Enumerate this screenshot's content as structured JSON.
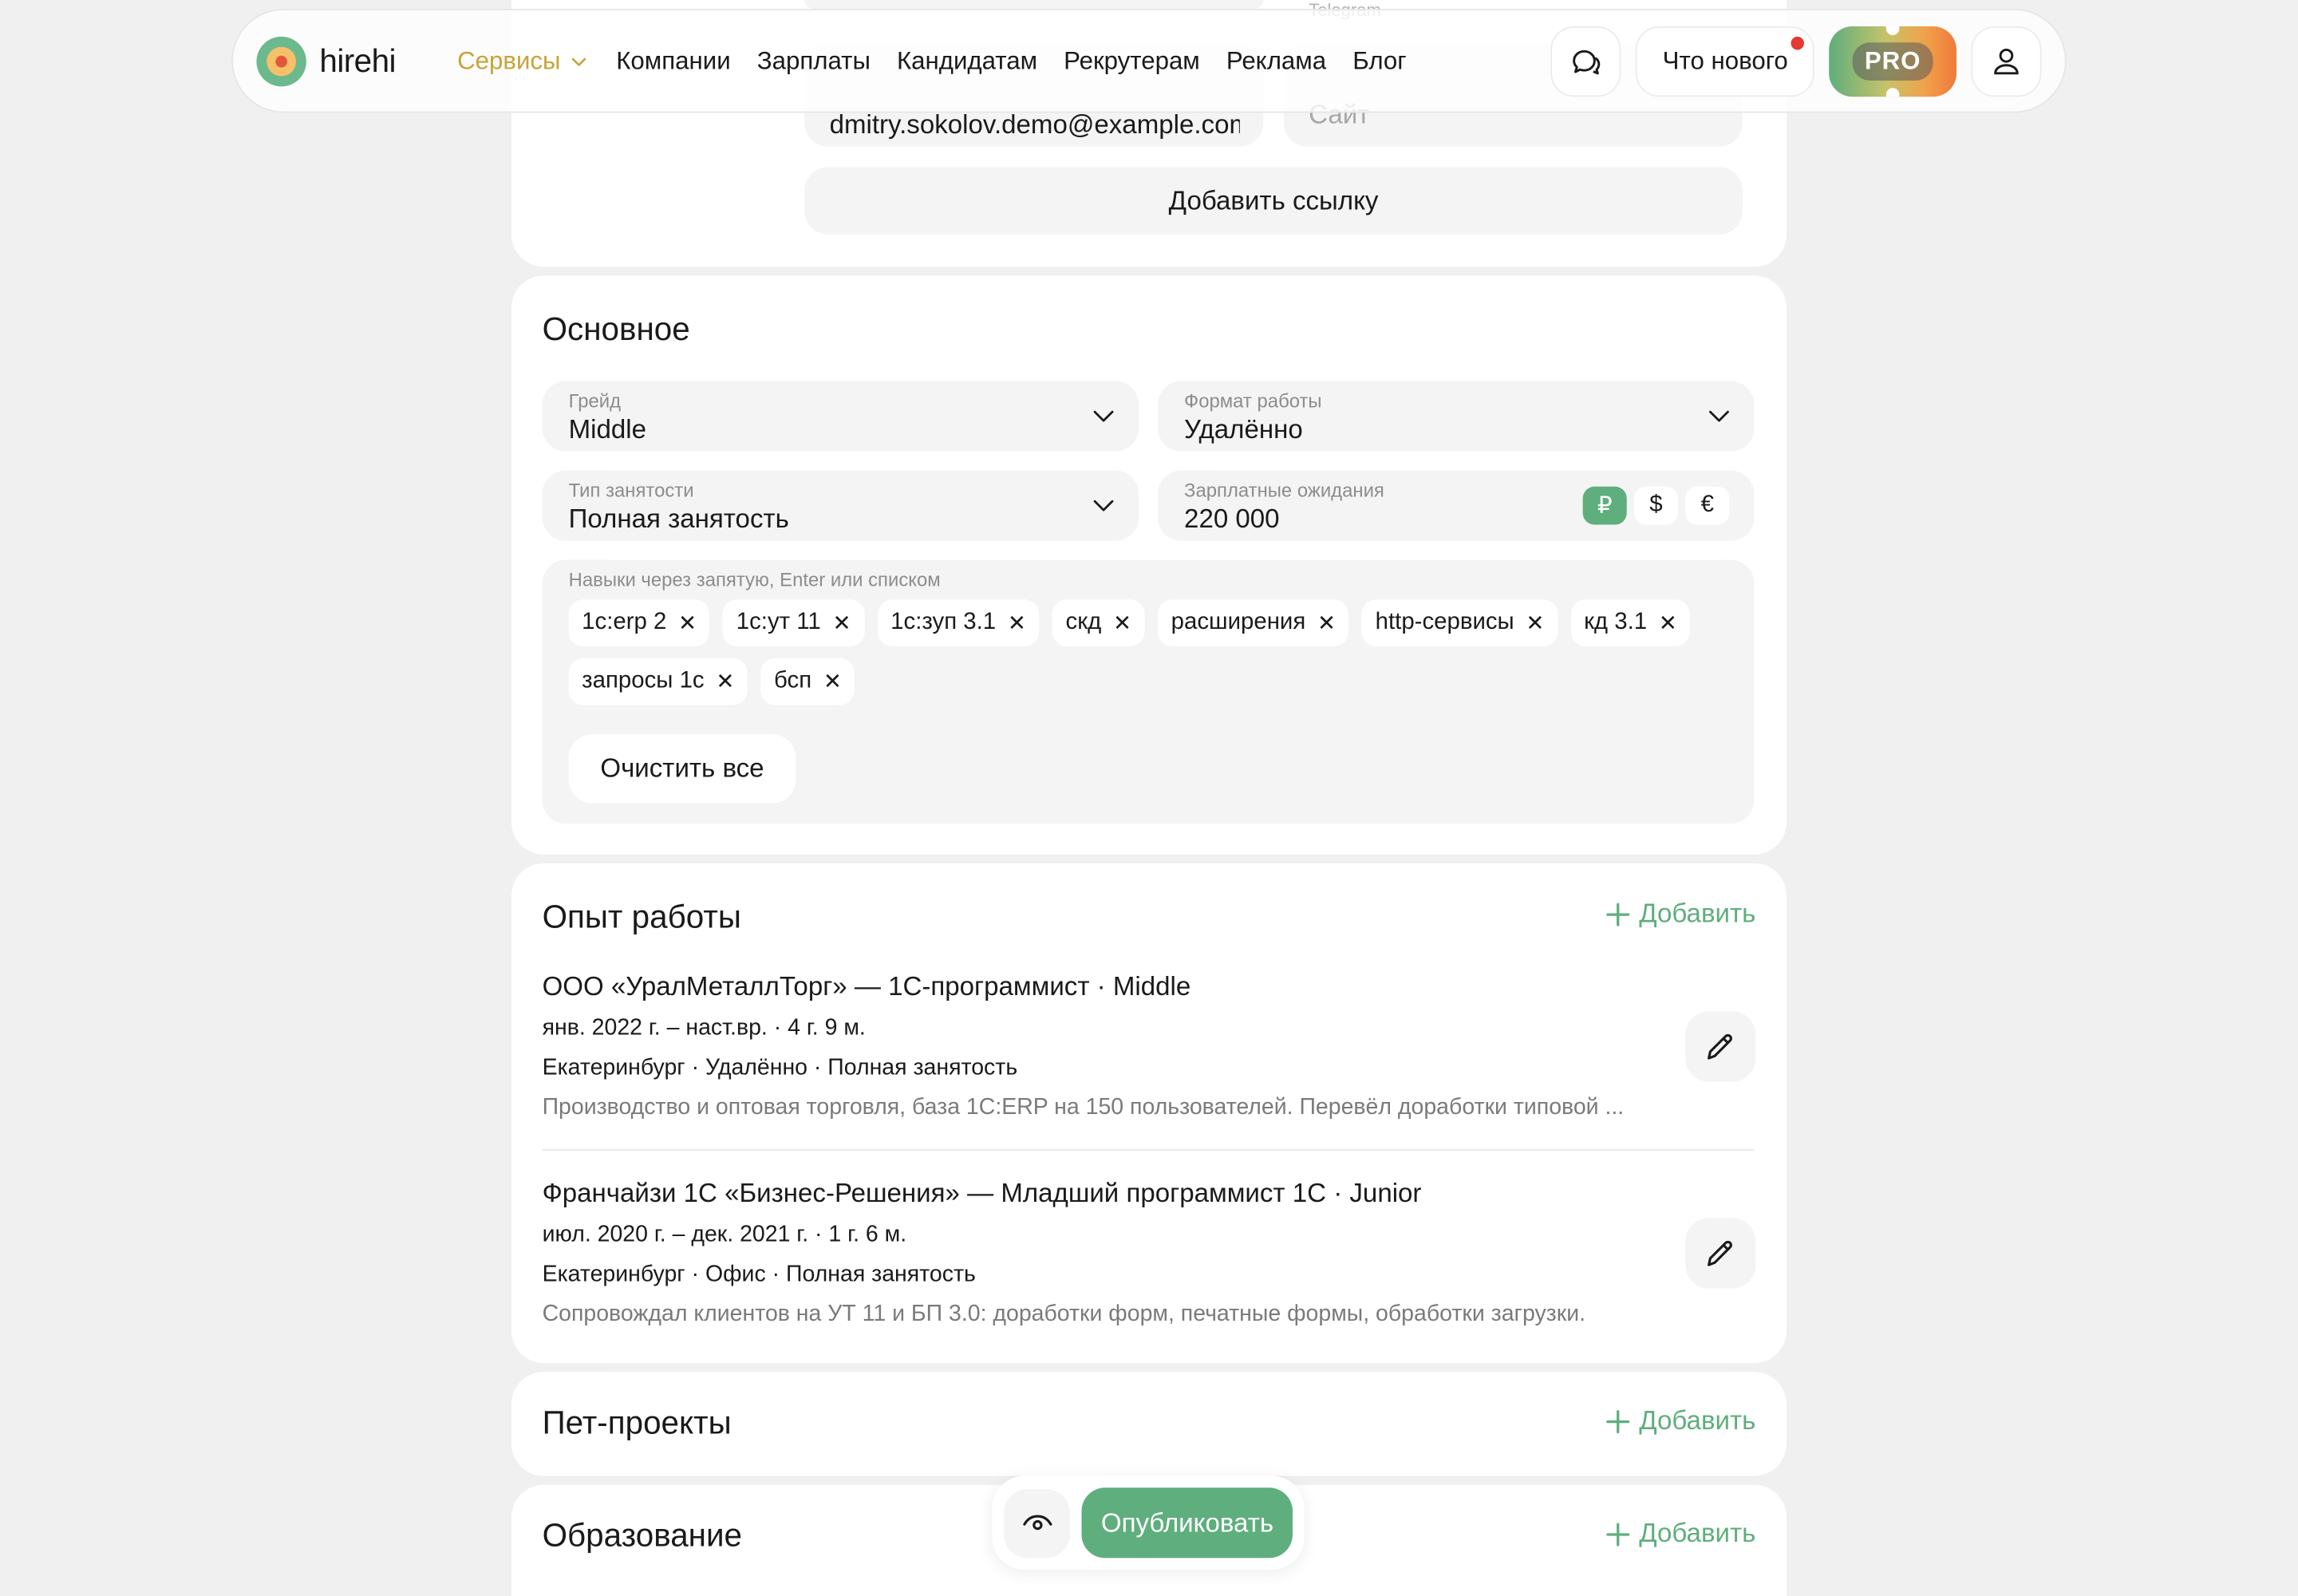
{
  "header": {
    "logo_text": "hirehi",
    "nav": {
      "services": "Сервисы",
      "companies": "Компании",
      "salaries": "Зарплаты",
      "candidates": "Кандидатам",
      "recruiters": "Рекрутерам",
      "ads": "Реклама",
      "blog": "Блог"
    },
    "whats_new": "Что нового",
    "pro": "PRO",
    "accent_color": "#5fae7d",
    "services_color": "#c8a33a"
  },
  "contacts": {
    "telegram_label": "Telegram",
    "email_value": "dmitry.sokolov.demo@example.com",
    "site_placeholder": "Сайт",
    "add_link": "Добавить ссылку"
  },
  "basic": {
    "title": "Основное",
    "grade": {
      "label": "Грейд",
      "value": "Middle"
    },
    "work_format": {
      "label": "Формат работы",
      "value": "Удалённо"
    },
    "employment": {
      "label": "Тип занятости",
      "value": "Полная занятость"
    },
    "salary": {
      "label": "Зарплатные ожидания",
      "value": "220 000",
      "currencies": [
        "₽",
        "$",
        "€"
      ],
      "selected_currency": "₽"
    },
    "skills_label": "Навыки через запятую, Enter или списком",
    "skills": [
      "1с:erp 2",
      "1с:ут 11",
      "1с:зуп 3.1",
      "скд",
      "расширения",
      "http-сервисы",
      "кд 3.1",
      "запросы 1с",
      "бсп"
    ],
    "clear_all": "Очистить все"
  },
  "experience": {
    "title": "Опыт работы",
    "add": "Добавить",
    "items": [
      {
        "title": "ООО «УралМеталлТорг» — 1С-программист · Middle",
        "period": "янв. 2022 г. – наст.вр. · 4 г. 9 м.",
        "meta": "Екатеринбург · Удалённо · Полная занятость",
        "description": "Производство и оптовая торговля, база 1С:ERP на 150 пользователей. Перевёл доработки типовой ..."
      },
      {
        "title": "Франчайзи 1С «Бизнес-Решения» — Младший программист 1С · Junior",
        "period": "июл. 2020 г. – дек. 2021 г. · 1 г. 6 м.",
        "meta": "Екатеринбург · Офис · Полная занятость",
        "description": "Сопровождал клиентов на УТ 11 и БП 3.0: доработки форм, печатные формы, обработки загрузки."
      }
    ]
  },
  "pet_projects": {
    "title": "Пет-проекты",
    "add": "Добавить"
  },
  "education": {
    "title": "Образование",
    "add": "Добавить"
  },
  "publish_bar": {
    "publish": "Опубликовать",
    "preview_icon": "eye-icon"
  }
}
